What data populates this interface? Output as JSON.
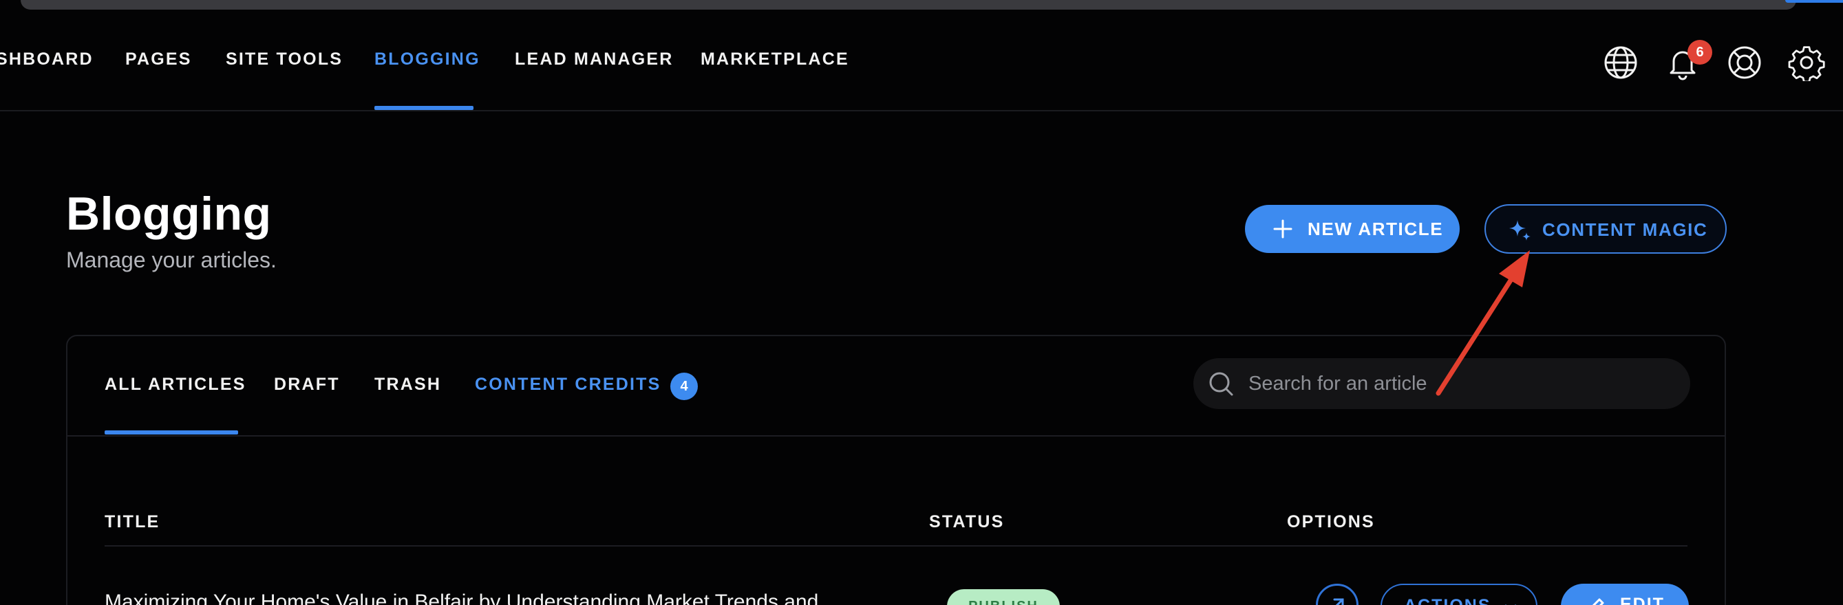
{
  "nav": {
    "items": [
      {
        "label": "SHBOARD",
        "active": false
      },
      {
        "label": "PAGES",
        "active": false
      },
      {
        "label": "SITE TOOLS",
        "active": false
      },
      {
        "label": "BLOGGING",
        "active": true
      },
      {
        "label": "LEAD MANAGER",
        "active": false
      },
      {
        "label": "MARKETPLACE",
        "active": false
      }
    ],
    "icons": [
      "globe-icon",
      "bell-icon",
      "lifebuoy-icon",
      "gear-icon"
    ],
    "notification_count": "6"
  },
  "header": {
    "title": "Blogging",
    "subtitle": "Manage your articles.",
    "new_article_label": "NEW ARTICLE",
    "content_magic_label": "CONTENT MAGIC"
  },
  "tabs": {
    "items": [
      "ALL ARTICLES",
      "DRAFT",
      "TRASH",
      "CONTENT CREDITS"
    ],
    "active": "ALL ARTICLES",
    "credits_count": "4"
  },
  "search": {
    "placeholder": "Search for an article",
    "value": ""
  },
  "table": {
    "columns": [
      "TITLE",
      "STATUS",
      "OPTIONS"
    ],
    "rows": [
      {
        "title": "Maximizing Your Home's Value in Belfair by Understanding Market Trends and",
        "status": "PUBLISH",
        "actions_label": "ACTIONS",
        "edit_label": "EDIT"
      }
    ]
  },
  "colors": {
    "accent": "#3d8bf0",
    "background": "#030304",
    "badge_red": "#e14336",
    "annotation_arrow": "#e3402f",
    "status_publish_bg": "#b7ecc4"
  }
}
